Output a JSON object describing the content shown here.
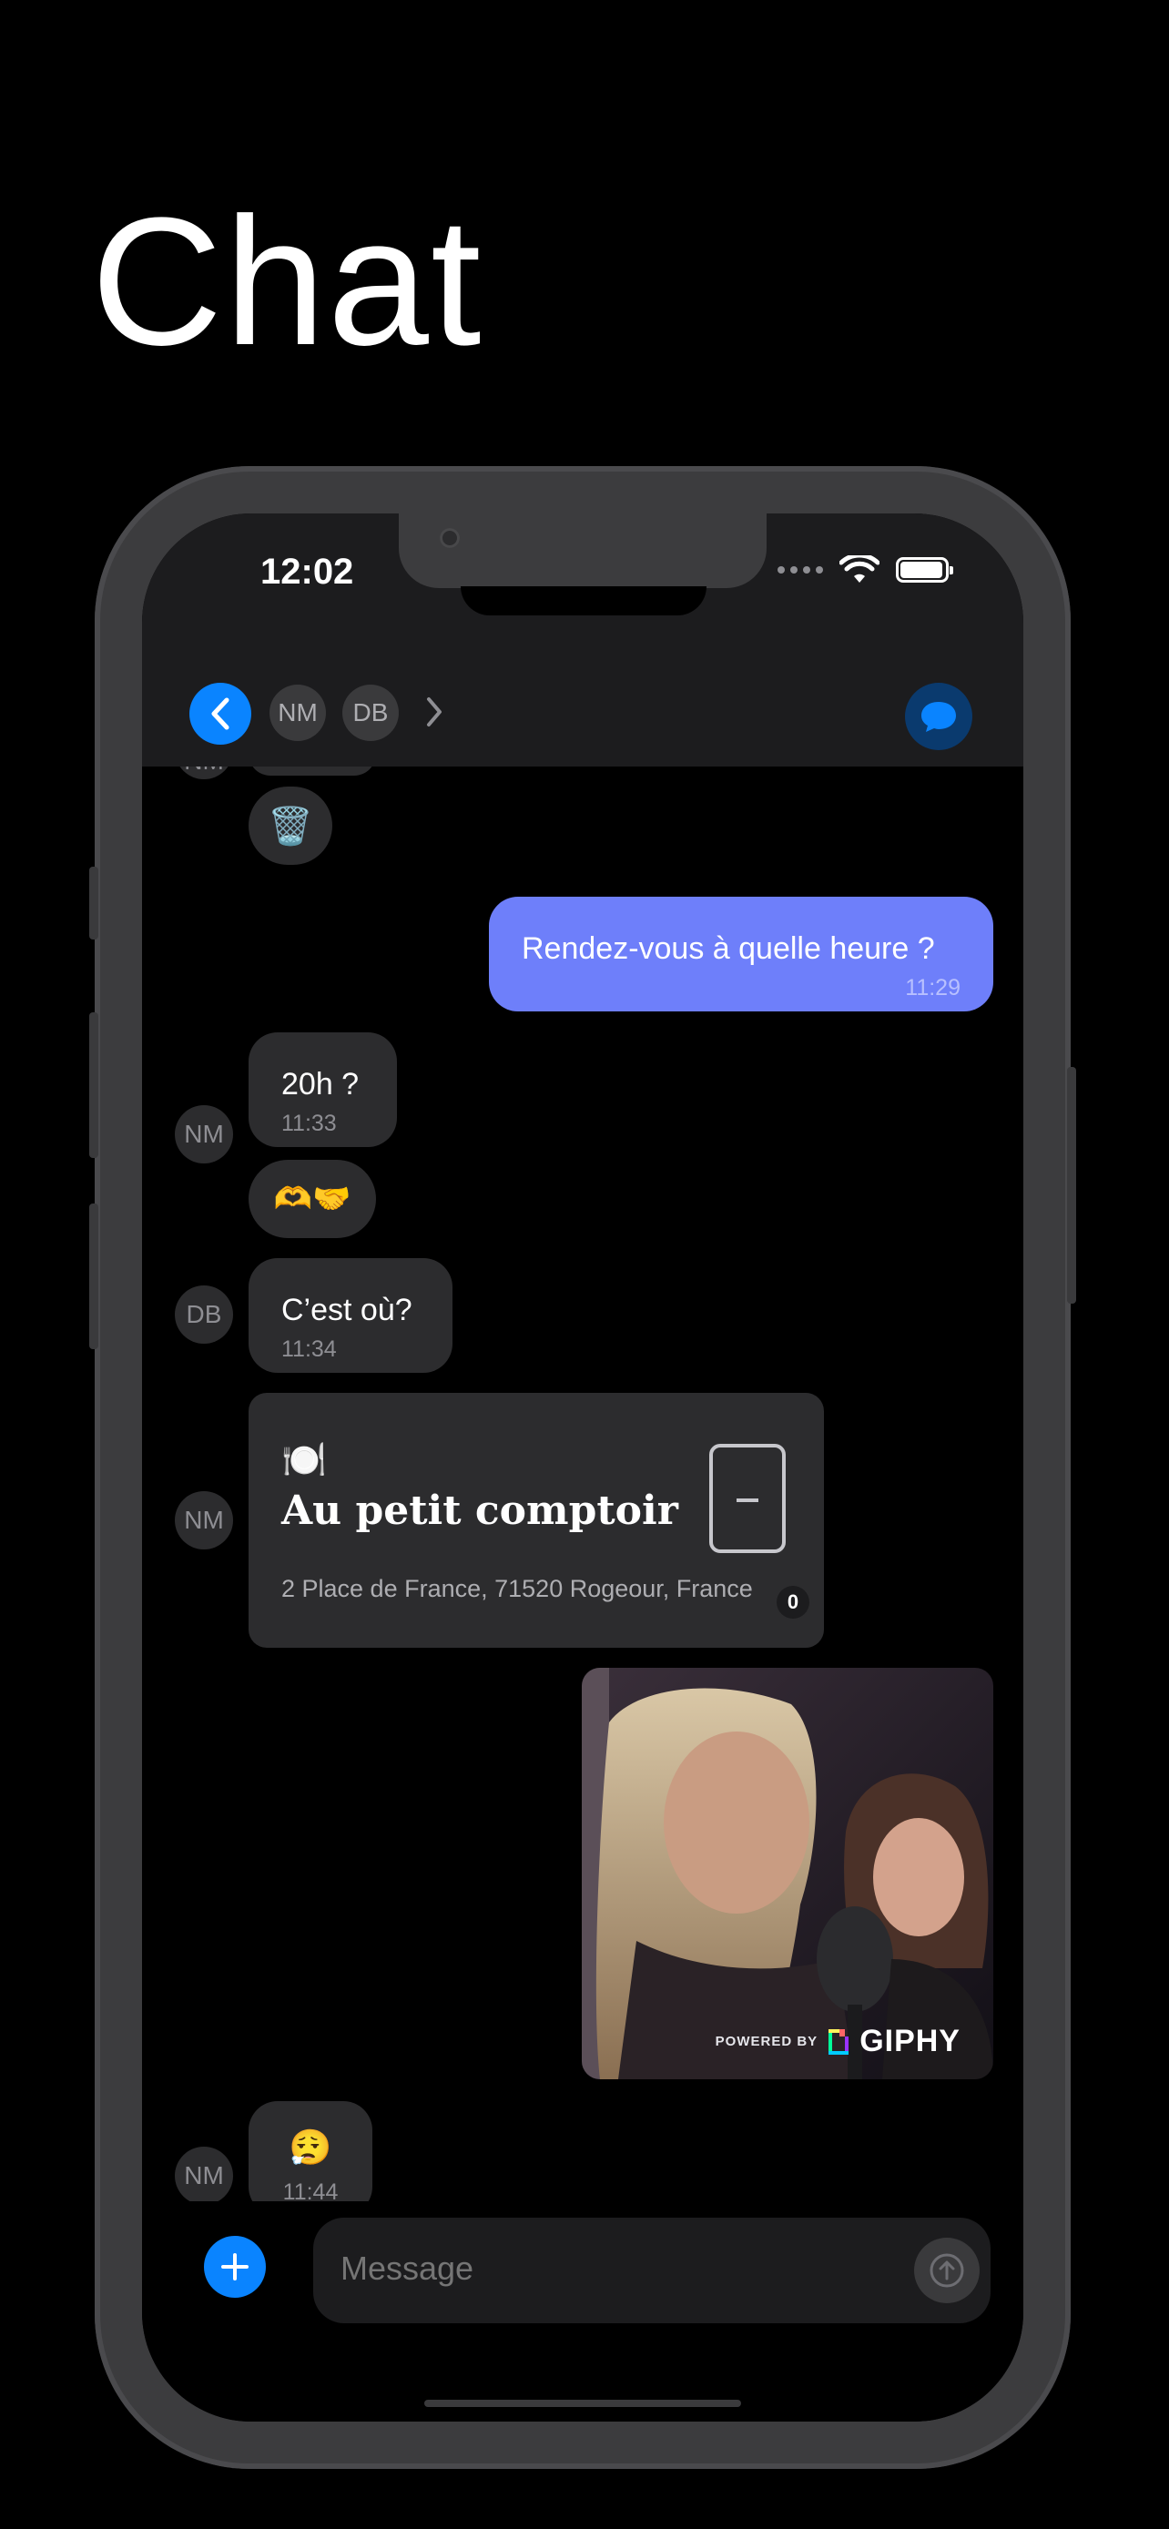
{
  "page": {
    "title": "Chat"
  },
  "status_bar": {
    "time": "12:02"
  },
  "header": {
    "participants": [
      "NM",
      "DB"
    ],
    "colors": {
      "accent": "#0a84ff"
    },
    "icons": {
      "back": "chevron-left-icon",
      "more": "chevron-right-icon",
      "chat": "chat-bubble-icon"
    }
  },
  "messages": {
    "top_partial": {
      "avatar": "NM",
      "emoji": "🗑️"
    },
    "out1": {
      "text": "Rendez-vous à quelle heure ?",
      "time": "11:29"
    },
    "in1": {
      "avatar": "NM",
      "text": "20h ?",
      "time": "11:33",
      "reaction": "🫶🤝"
    },
    "in2": {
      "avatar": "DB",
      "text": "C’est où?",
      "time": "11:34"
    },
    "place_card": {
      "avatar": "NM",
      "icon": "🍽️",
      "name": "Au petit comptoir",
      "address": "2 Place de France, 71520 Rogeour, France",
      "badge": "0"
    },
    "gif": {
      "powered_by": "POWERED BY",
      "brand": "GIPHY"
    },
    "in3": {
      "avatar": "NM",
      "emoji": "😮‍💨",
      "time": "11:44",
      "seen_icon": "eye-icon"
    }
  },
  "composer": {
    "placeholder": "Message"
  }
}
